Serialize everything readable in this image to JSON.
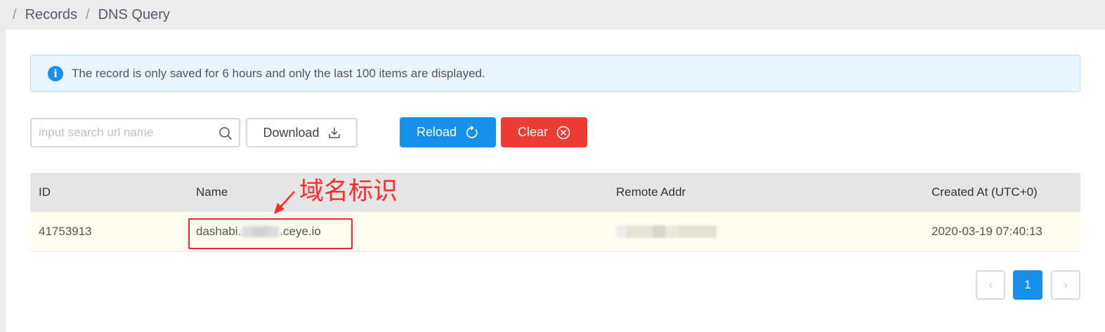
{
  "breadcrumb": {
    "separator": "/",
    "items": [
      "Records",
      "DNS Query"
    ]
  },
  "alert": {
    "icon": "info-icon",
    "icon_glyph": "i",
    "message": "The record is only saved for 6 hours and only the last 100 items are displayed.",
    "background_color": "#ebf5fe",
    "icon_color": "#1890ee"
  },
  "toolbar": {
    "search_placeholder": "input search url name",
    "search_value": "",
    "download_label": "Download",
    "reload_label": "Reload",
    "clear_label": "Clear",
    "reload_color": "#1790ec",
    "clear_color": "#ee3b34"
  },
  "table": {
    "columns": [
      "ID",
      "Name",
      "Remote Addr",
      "Created At (UTC+0)"
    ],
    "rows": [
      {
        "id": "41753913",
        "name_prefix": "dashabi.",
        "name_suffix": ".ceye.io",
        "name_redacted": true,
        "remote_addr_redacted": true,
        "created_at": "2020-03-19 07:40:13"
      }
    ]
  },
  "annotation": {
    "text": "域名标识",
    "color": "#ff2a2a"
  },
  "pagination": {
    "prev_glyph": "‹",
    "current_page": "1",
    "next_glyph": "›"
  }
}
